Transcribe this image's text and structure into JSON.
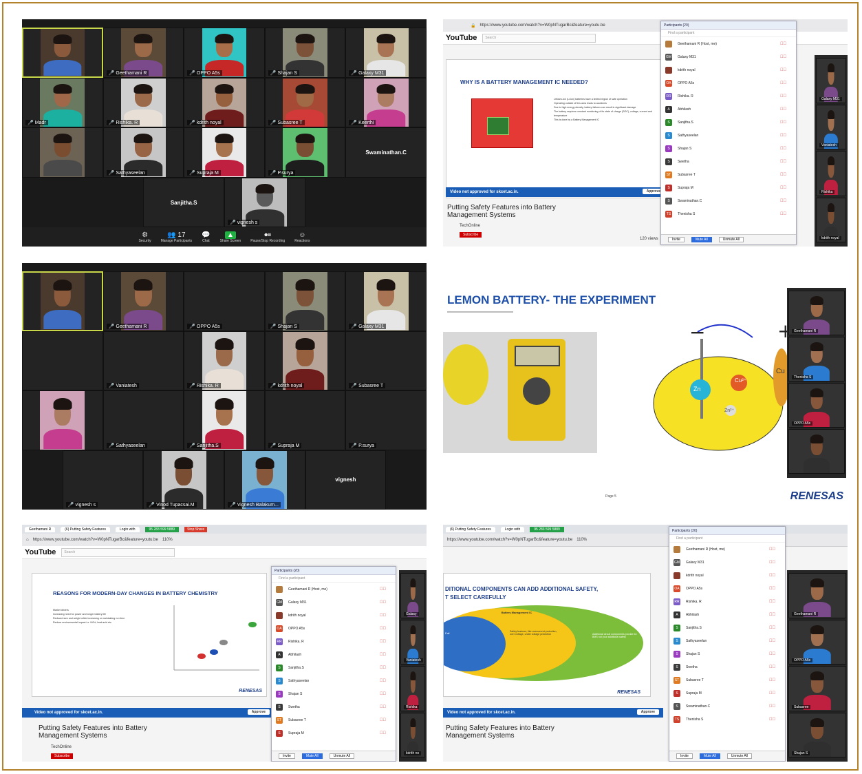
{
  "zoom1": {
    "tiles": [
      {
        "name": "",
        "skin": "#8b5a3c",
        "shirt": "#3d6cc0",
        "bg": "#4a3a2e",
        "active": true
      },
      {
        "name": "Geethamani R",
        "skin": "#9c6a48",
        "shirt": "#7a4a8a",
        "bg": "#5b4a38"
      },
      {
        "name": "OPPO A5s",
        "skin": "#a86e4a",
        "shirt": "#c62828",
        "bg": "#30c4c4"
      },
      {
        "name": "Shajan S",
        "skin": "#7c5238",
        "shirt": "#333333",
        "bg": "#8b8b7a"
      },
      {
        "name": "Galaxy M31",
        "skin": "#a87454",
        "shirt": "#e6e6e6",
        "bg": "#c9c0a8"
      },
      {
        "name": "Madr",
        "skin": "#a06848",
        "shirt": "#1bb0a0",
        "bg": "#6a7a60"
      },
      {
        "name": "Rishika. R",
        "skin": "#9a6a4a",
        "shirt": "#e8e0d6",
        "bg": "#cfcfcf"
      },
      {
        "name": "kdrith noyal",
        "skin": "#96603e",
        "shirt": "#6e1c1c",
        "bg": "#b7a59a"
      },
      {
        "name": "Subasree T",
        "skin": "#a06a46",
        "shirt": "#d23a3a",
        "bg": "#a64a35"
      },
      {
        "name": "Keerthi",
        "skin": "#ab7c62",
        "shirt": "#c43d8e",
        "bg": "#d0a2b8"
      },
      {
        "name": "",
        "skin": "#7a4d30",
        "shirt": "#4a4a4a",
        "bg": "#6d6355"
      },
      {
        "name": "Sathyaseelan",
        "skin": "#986446",
        "shirt": "#2b2b2b",
        "bg": "#c6c6c6"
      },
      {
        "name": "Supraja M",
        "skin": "#a7734e",
        "shirt": "#c02040",
        "bg": "#e9e9e9"
      },
      {
        "name": "P.surya",
        "skin": "#7a4e32",
        "shirt": "#1d1d1d",
        "bg": "#5fbf70"
      },
      {
        "name": "",
        "center": "Swaminathan.C"
      },
      {
        "name": "",
        "center": "Sanjitha.S"
      },
      {
        "name": "vignesh s",
        "skin": "#5a5a5a",
        "shirt": "#303030",
        "bg": "#bdbdbd"
      }
    ],
    "toolbar": [
      {
        "icon": "⚙",
        "label": "Security",
        "name": "security-button"
      },
      {
        "icon": "👥 17",
        "label": "Manage Participants",
        "name": "manage-participants-button"
      },
      {
        "icon": "💬",
        "label": "Chat",
        "name": "chat-button"
      },
      {
        "icon": "▲",
        "label": "Share Screen",
        "name": "share-screen-button",
        "green": true
      },
      {
        "icon": "⏺⏸",
        "label": "Pause/Stop Recording",
        "name": "recording-button"
      },
      {
        "icon": "☺",
        "label": "Reactions",
        "name": "reactions-button"
      }
    ]
  },
  "zoom2": {
    "tiles": [
      {
        "name": "",
        "skin": "#8b5a3c",
        "shirt": "#3d6cc0",
        "bg": "#4a3a2e",
        "active": true
      },
      {
        "name": "Geethamani R",
        "skin": "#9c6a48",
        "shirt": "#7a4a8a",
        "bg": "#5b4a38"
      },
      {
        "name": "OPPO A5s",
        "skin": "",
        "bg": ""
      },
      {
        "name": "Shajan S",
        "skin": "#7c5238",
        "shirt": "#333333",
        "bg": "#8b8b7a"
      },
      {
        "name": "Galaxy M31",
        "skin": "#a87454",
        "shirt": "#e6e6e6",
        "bg": "#c9c0a8"
      },
      {
        "name": "",
        "skin": "",
        "bg": ""
      },
      {
        "name": "Vaniatesh",
        "skin": "",
        "bg": ""
      },
      {
        "name": "Rishika. R",
        "skin": "#9a6a4a",
        "shirt": "#e8e0d6",
        "bg": "#cfcfcf"
      },
      {
        "name": "kdrith noyal",
        "skin": "#96603e",
        "shirt": "#6e1c1c",
        "bg": "#b7a59a"
      },
      {
        "name": "Subasree T",
        "skin": "",
        "bg": ""
      },
      {
        "name": "",
        "skin": "#ab7c62",
        "shirt": "#c43d8e",
        "bg": "#d0a2b8"
      },
      {
        "name": "Sathyaseelan",
        "skin": "",
        "bg": ""
      },
      {
        "name": "Sanjitha.S",
        "skin": "#a7734e",
        "shirt": "#c02040",
        "bg": "#e9e9e9"
      },
      {
        "name": "Supraja M",
        "skin": "",
        "bg": ""
      },
      {
        "name": "P.surya",
        "skin": "",
        "bg": ""
      },
      {
        "name": "vignesh s",
        "skin": "",
        "bg": ""
      },
      {
        "name": "Vinod Tupacsai.M",
        "skin": "#7a4e32",
        "shirt": "#2b2b2b",
        "bg": "#c6c6c6"
      },
      {
        "name": "Vignesh Balakum...",
        "skin": "#86573a",
        "shirt": "#3a7bd5",
        "bg": "#7ab0d0"
      },
      {
        "name": "",
        "center": "vignesh"
      }
    ]
  },
  "browser": {
    "url": "https://www.youtube.com/watch?v=W0pNTugarBc&feature=youtu.be",
    "search_placeholder": "Search",
    "youtube": "YouTube",
    "tab1": "Geethamani R",
    "tab2": "(6) Putting Safety Features",
    "tab3": "Login with",
    "call_number": "95 283 599 5889",
    "stop_share": "Stop Share",
    "zoom_level": "110%",
    "notice": "Video not approved for skcet.ac.in.",
    "approve": "Approve",
    "video_title_1": "Putting Safety Features into Battery",
    "video_title_2": "Management Systems",
    "channel": "TechOnline",
    "subscribe": "Subscribe",
    "views": "120 views"
  },
  "slides": {
    "battery_ic": "WHY IS A BATTERY MANAGEMENT IC NEEDED?",
    "lemon": "LEMON BATTERY- THE EXPERIMENT",
    "chemistry": "REASONS FOR MODERN-DAY CHANGES IN BATTERY CHEMISTRY",
    "additional_1": "DITIONAL COMPONENTS CAN ADD ADDITIONAL SAFETY,",
    "additional_2": "T SELECT CAREFULLY",
    "renesas": "RENESAS",
    "lemon_footer": "Page 5",
    "ion_labels": [
      "Zn",
      "Cu²⁺",
      "Zn²⁺",
      "Cu"
    ],
    "bullets": [
      "Lithium-Ion (Li-Ion) batteries have a limited region of safe operation",
      "Operating outside of this area leads to accidents",
      "Due to high energy density, battery failures can result in significant damage",
      "The battery requires constant monitoring of its state of charge (SOC), voltage, current and temperature",
      "This is done by a Battery Management IC"
    ],
    "chem_bullets": [
      "Market drivers",
      "Increasing need for power and longer battery life",
      "Reduced size and weight while increasing or maintaining run time",
      "Reduce environmental impact i.e. NiCd, lead-acid etc."
    ],
    "venn": [
      "Battery Management IC",
      "Safety features, like overcurrent protection, over voltage, under voltage protection",
      "Additional circuit components provide for BMS not your additional safety",
      "Fail"
    ]
  },
  "participants": {
    "header": "Participants (20)",
    "find": "Find a participant",
    "list": [
      {
        "name": "Geethamani R (Host, me)",
        "initials": "",
        "color": "#b57b3c"
      },
      {
        "name": "Galaxy M31",
        "initials": "GM",
        "color": "#555555"
      },
      {
        "name": "kdrith noyal",
        "initials": "",
        "color": "#8a3a2a"
      },
      {
        "name": "OPPO A5s",
        "initials": "OA",
        "color": "#d94a2a"
      },
      {
        "name": "Rishika. R",
        "initials": "RR",
        "color": "#7b5bc8"
      },
      {
        "name": "Abhilash",
        "initials": "A",
        "color": "#333333"
      },
      {
        "name": "Sanjitha.S",
        "initials": "S",
        "color": "#2a8a2a"
      },
      {
        "name": "Sathyaseelan",
        "initials": "S",
        "color": "#2a8ad0"
      },
      {
        "name": "Shajan S",
        "initials": "S",
        "color": "#9a3ac0"
      },
      {
        "name": "Swetha",
        "initials": "S",
        "color": "#3a3a3a"
      },
      {
        "name": "Subasree T",
        "initials": "ST",
        "color": "#e07a20"
      },
      {
        "name": "Supraja M",
        "initials": "S",
        "color": "#c0302a"
      },
      {
        "name": "Swaminathan.C",
        "initials": "S",
        "color": "#555555"
      },
      {
        "name": "Thenisha S",
        "initials": "TS",
        "color": "#d0402a"
      }
    ],
    "invite": "Invite",
    "mute_all": "Mute All",
    "unmute_all": "Unmute All"
  },
  "side_tiles_right": [
    "Galaxy M31",
    "Vaniatesh",
    "Rishika",
    "kdrith noyal"
  ],
  "side_tiles_lemon": [
    "Geethamani R",
    "Thenisha S",
    "OPPO A5s",
    ""
  ],
  "side_tiles_bl": [
    "Galaxy",
    "Vaniatesh",
    "Rishika",
    "kdrith no"
  ],
  "side_tiles_br": [
    "Geethamani R",
    "OPPO A5s",
    "Subasree",
    "Shajan S"
  ]
}
